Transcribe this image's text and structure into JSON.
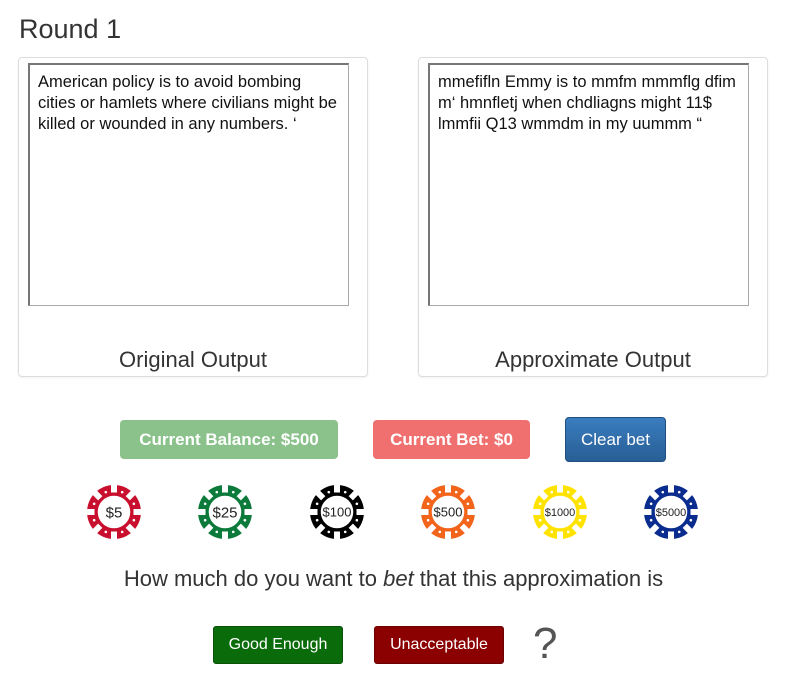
{
  "round_title": "Round 1",
  "original": {
    "text": "American policy is to avoid bombing cities or hamlets where civilians might be killed or wounded in any numbers. ‘",
    "caption": "Original Output"
  },
  "approximate": {
    "text": "mmefifln Emmy is to mmfm mmmflg dfim m‘ hmnfletj when chdliagns might 11$ lmmfii Q13 wmmdm in my uummm “",
    "caption": "Approximate Output"
  },
  "balance_label": "Current Balance: $500",
  "bet_label": "Current Bet: $0",
  "clear_bet_label": "Clear bet",
  "chips": [
    {
      "label": "$5",
      "color": "#c8102e",
      "text_size": 15
    },
    {
      "label": "$25",
      "color": "#0b7a3b",
      "text_size": 15
    },
    {
      "label": "$100",
      "color": "#000000",
      "text_size": 13
    },
    {
      "label": "$500",
      "color": "#f26419",
      "text_size": 13
    },
    {
      "label": "$1000",
      "color": "#ffe200",
      "text_size": 11
    },
    {
      "label": "$5000",
      "color": "#0a2c8f",
      "text_size": 11
    }
  ],
  "question": {
    "before": "How much do you want to ",
    "emph": "bet",
    "after": " that this approximation is"
  },
  "good_enough_label": "Good Enough",
  "unacceptable_label": "Unacceptable",
  "question_mark": "?"
}
